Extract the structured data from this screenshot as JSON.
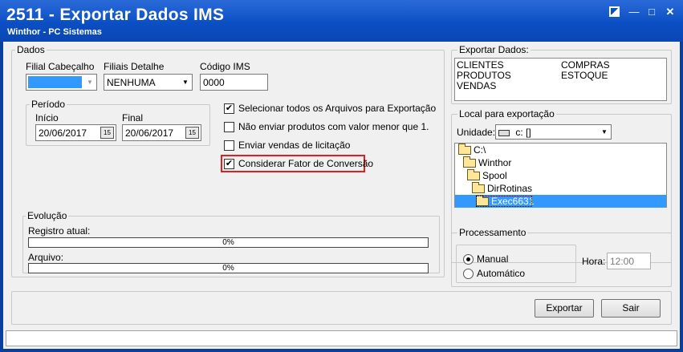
{
  "window": {
    "title": "2511 - Exportar Dados IMS",
    "subtitle": "Winthor - PC Sistemas",
    "minimize": "—",
    "maximize": "□",
    "close": "✕"
  },
  "dados": {
    "legend": "Dados",
    "filial_cabecalho_label": "Filial Cabeçalho",
    "filial_cabecalho_value": "",
    "filiais_detalhe_label": "Filiais Detalhe",
    "filiais_detalhe_value": "NENHUMA",
    "codigo_ims_label": "Código IMS",
    "codigo_ims_value": "0000",
    "periodo": {
      "legend": "Período",
      "inicio_label": "Início",
      "inicio_value": "20/06/2017",
      "final_label": "Final",
      "final_value": "20/06/2017",
      "calendar_glyph": "15"
    },
    "checkboxes": [
      {
        "label": "Selecionar todos os Arquivos para Exportação",
        "checked": true
      },
      {
        "label": "Não enviar produtos com valor menor que 1.",
        "checked": false
      },
      {
        "label": "Enviar vendas de licitação",
        "checked": false
      },
      {
        "label": "Considerar Fator de Conversão",
        "checked": true
      }
    ],
    "check_glyph": "✔",
    "evolucao": {
      "legend": "Evolução",
      "registro_label": "Registro atual:",
      "registro_value": "0%",
      "arquivo_label": "Arquivo:",
      "arquivo_value": "0%"
    }
  },
  "exportar_dados": {
    "legend": "Exportar Dados:",
    "col1": [
      "CLIENTES",
      "PRODUTOS",
      "VENDAS"
    ],
    "col2": [
      "COMPRAS",
      "ESTOQUE"
    ]
  },
  "local": {
    "legend": "Local para exportação",
    "unidade_label": "Unidade:",
    "unidade_value": "c: []",
    "tree": [
      "C:\\",
      "Winthor",
      "Spool",
      "DirRotinas",
      "Exec6631"
    ],
    "selected": "Exec6631"
  },
  "processamento": {
    "legend": "Processamento",
    "manual_label": "Manual",
    "automatico_label": "Automático",
    "selected": "Manual",
    "hora_label": "Hora:",
    "hora_value": "12:00"
  },
  "buttons": {
    "exportar": "Exportar",
    "sair": "Sair"
  }
}
